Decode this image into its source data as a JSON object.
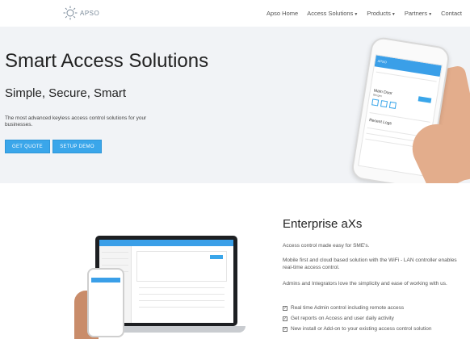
{
  "nav": {
    "logo_text": "APSO",
    "links": [
      {
        "label": "Apso Home",
        "dropdown": false
      },
      {
        "label": "Access Solutions",
        "dropdown": true
      },
      {
        "label": "Products",
        "dropdown": true
      },
      {
        "label": "Partners",
        "dropdown": true
      },
      {
        "label": "Contact",
        "dropdown": false
      }
    ]
  },
  "hero": {
    "title": "Smart Access Solutions",
    "subtitle": "Simple, Secure, Smart",
    "description": "The most advanced keyless access control solutions for your businesses.",
    "buttons": {
      "quote": "GET QUOTE",
      "demo": "SETUP DEMO"
    },
    "phone": {
      "app_name": "APSO",
      "door_name": "Main Door",
      "door_location": "Bergen",
      "section": "Recent Logs"
    }
  },
  "enterprise": {
    "title": "Enterprise aXs",
    "paragraphs": [
      "Access control made easy for SME's.",
      "Mobile first and cloud based solution with the WiFi - LAN controller enables real-time access control.",
      "Admins and Integrators love the simplicity and ease of working with us."
    ],
    "features": [
      "Real time Admin control including remote access",
      "Get reports on Access and user daily activity",
      "New install or Add-on to your existing access control solution"
    ]
  },
  "colors": {
    "accent": "#3aa6ea",
    "hero_bg": "#f1f3f6"
  }
}
